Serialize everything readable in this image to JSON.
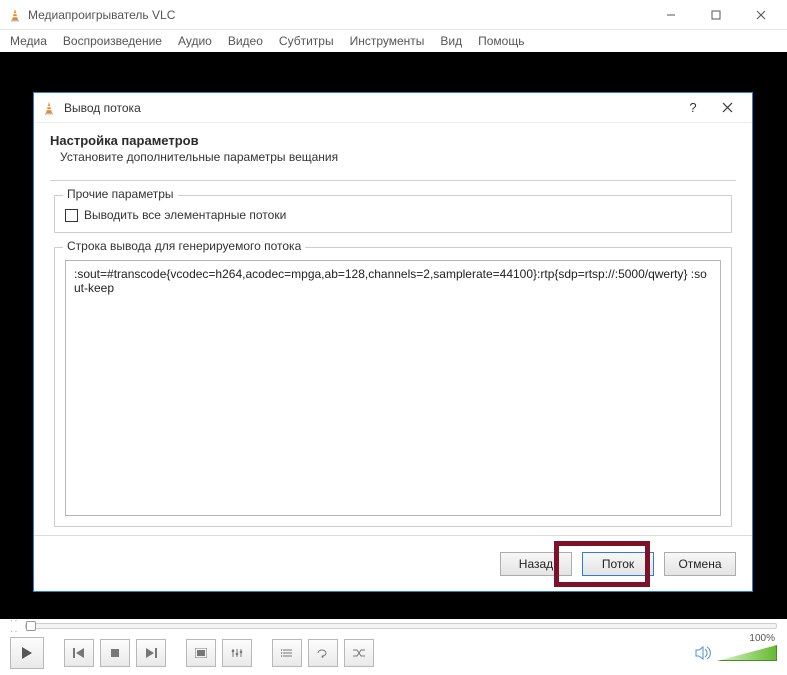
{
  "window": {
    "title": "Медиапроигрыватель VLC"
  },
  "menubar": {
    "items": [
      "Медиа",
      "Воспроизведение",
      "Аудио",
      "Видео",
      "Субтитры",
      "Инструменты",
      "Вид",
      "Помощь"
    ]
  },
  "dialog": {
    "title": "Вывод потока",
    "help_symbol": "?",
    "heading": "Настройка параметров",
    "subheading": "Установите дополнительные параметры вещания",
    "group_other_legend": "Прочие параметры",
    "checkbox_all_streams": "Выводить все элементарные потоки",
    "group_output_legend": "Строка вывода для генерируемого потока",
    "output_string": ":sout=#transcode{vcodec=h264,acodec=mpga,ab=128,channels=2,samplerate=44100}:rtp{sdp=rtsp://:5000/qwerty} :sout-keep",
    "buttons": {
      "back": "Назад",
      "stream": "Поток",
      "cancel": "Отмена"
    }
  },
  "player": {
    "volume_percent": "100%"
  }
}
